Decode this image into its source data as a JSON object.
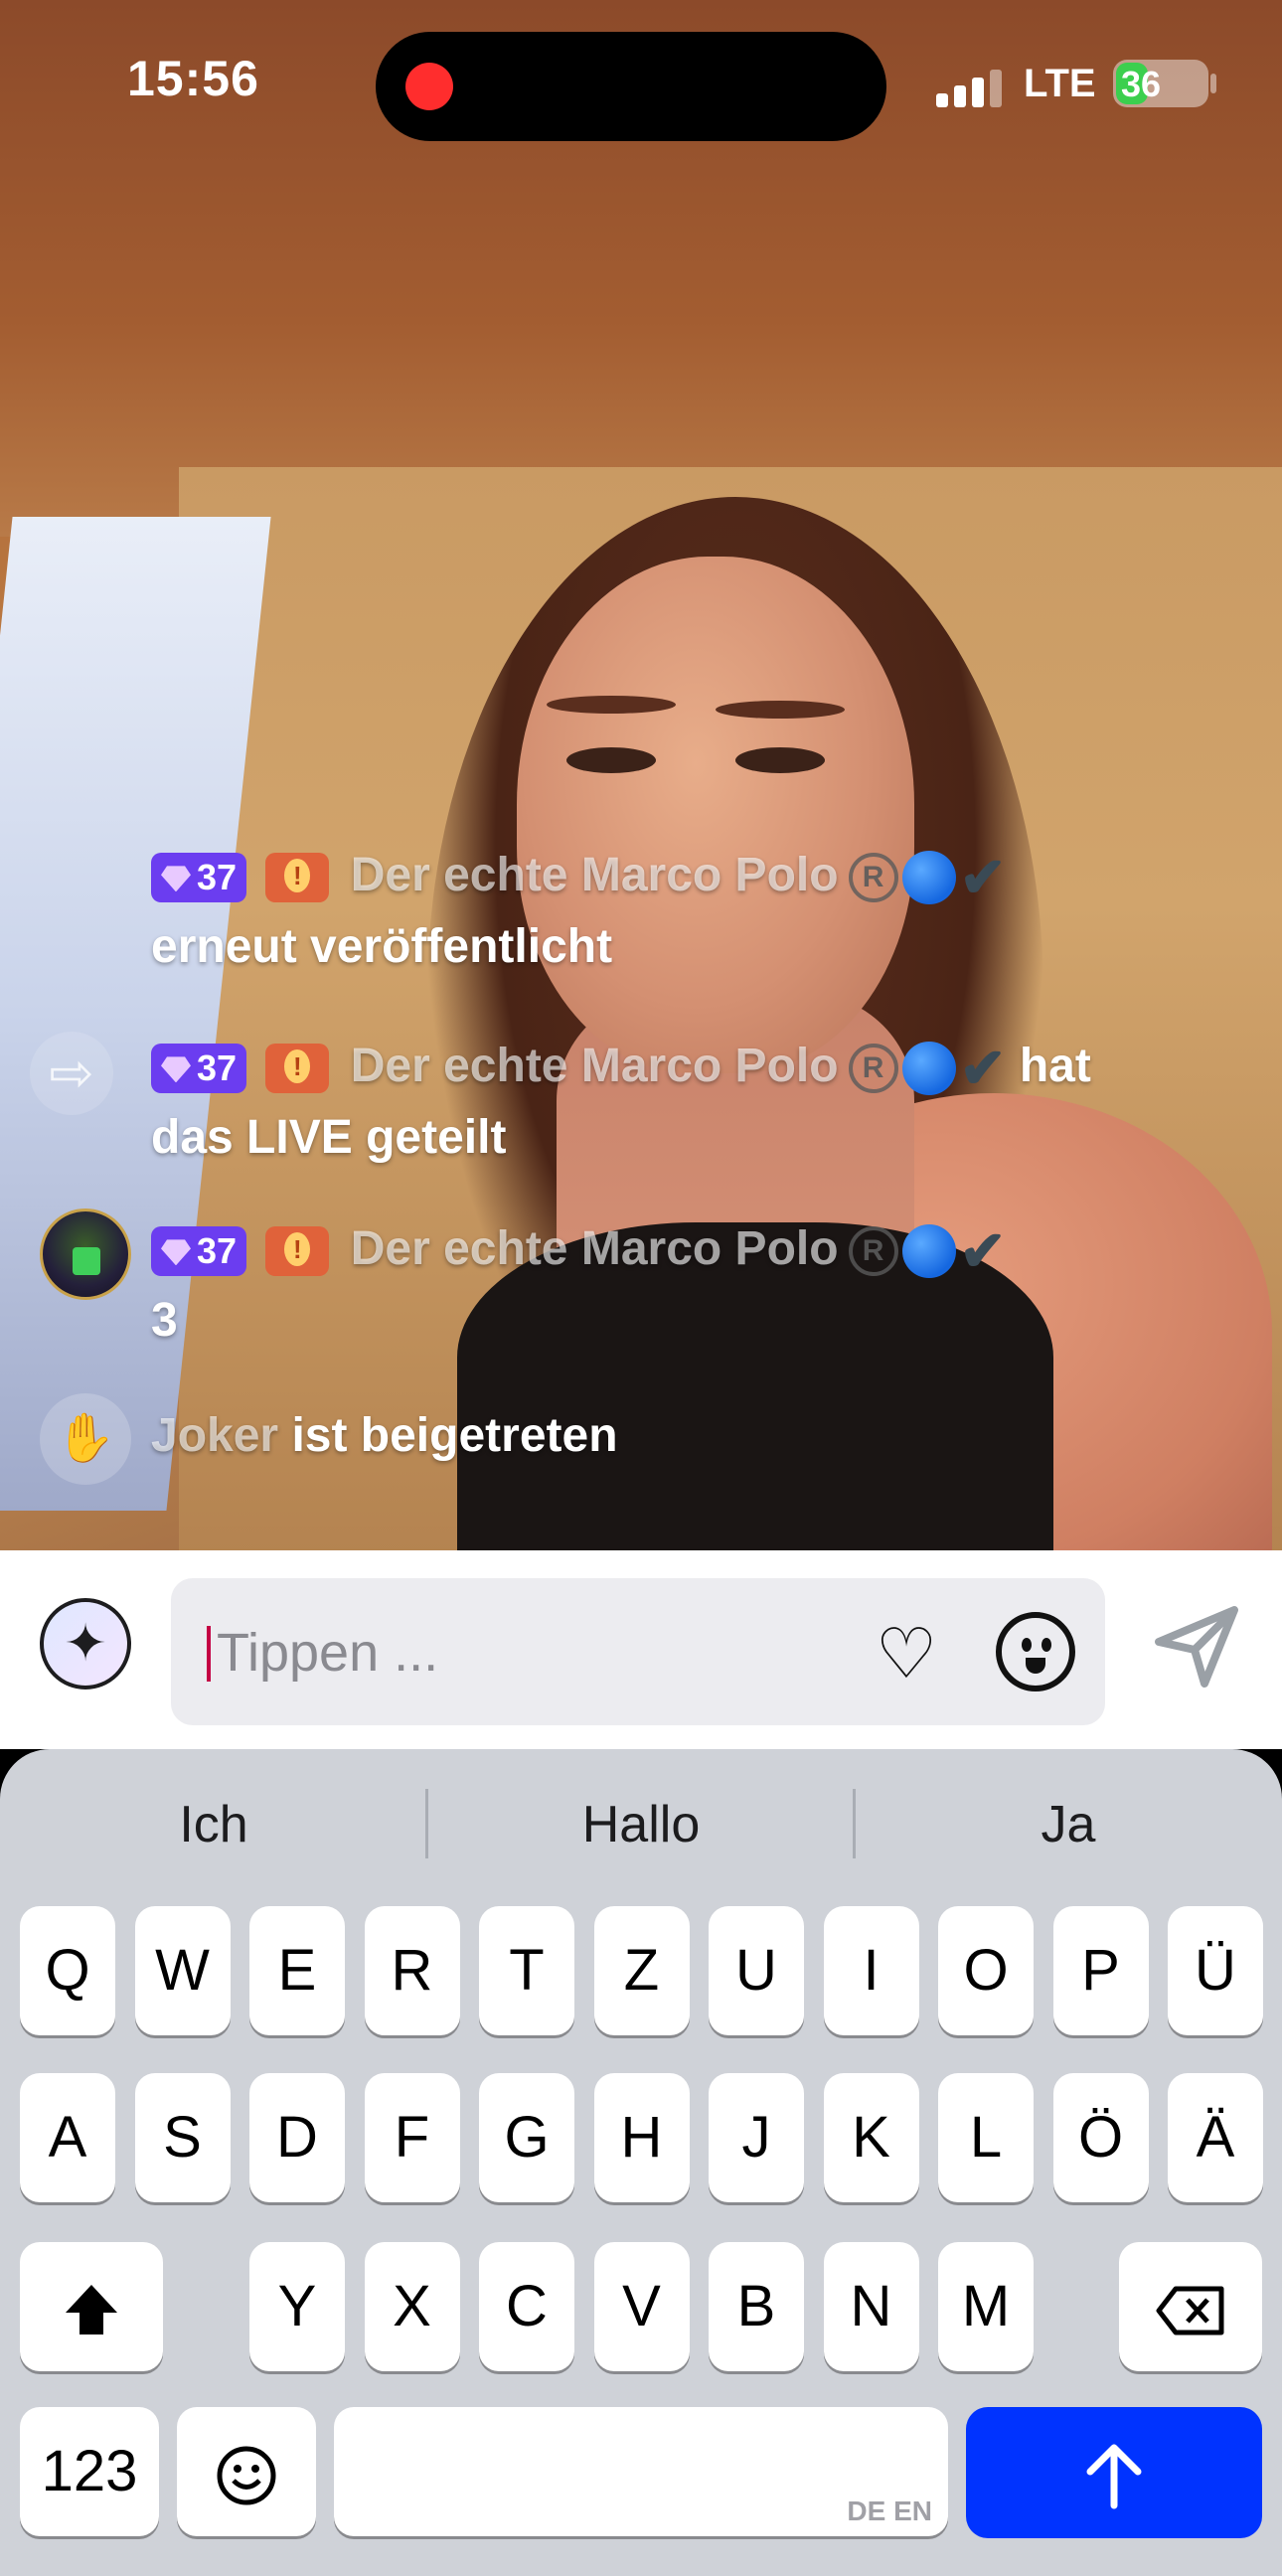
{
  "status_bar": {
    "time": "15:56",
    "network": "LTE",
    "battery": "36",
    "battery_level": 0.36,
    "recording": true
  },
  "chat": [
    {
      "level": "37",
      "name": "Der echte Marco Polo",
      "text": "erneut veröffentlicht"
    },
    {
      "level": "37",
      "name": "Der echte Marco Polo",
      "text_inline": "hat",
      "text": "das LIVE geteilt"
    },
    {
      "level": "37",
      "name": "Der echte Marco Polo",
      "text": "3"
    },
    {
      "name": "Joker",
      "text": "ist beigetreten"
    }
  ],
  "comment_bar": {
    "placeholder": "Tippen ..."
  },
  "keyboard": {
    "suggestions": [
      "Ich",
      "Hallo",
      "Ja"
    ],
    "row1": [
      "Q",
      "W",
      "E",
      "R",
      "T",
      "Z",
      "U",
      "I",
      "O",
      "P",
      "Ü"
    ],
    "row2": [
      "A",
      "S",
      "D",
      "F",
      "G",
      "H",
      "J",
      "K",
      "L",
      "Ö",
      "Ä"
    ],
    "row3": [
      "Y",
      "X",
      "C",
      "V",
      "B",
      "N",
      "M"
    ],
    "numbers_key": "123",
    "language_indicator": "DE EN",
    "return_color": "#0033ff"
  },
  "icons": {
    "share": "share-arrow-icon",
    "join": "wave-hand-icon",
    "sparkle": "sparkle-icon",
    "heart": "heart-icon",
    "emoji": "emoji-icon",
    "send": "send-icon",
    "shift": "shift-icon",
    "delete": "delete-icon",
    "keyboard_emoji": "emoji-keyboard-icon",
    "return": "return-arrow-icon"
  }
}
